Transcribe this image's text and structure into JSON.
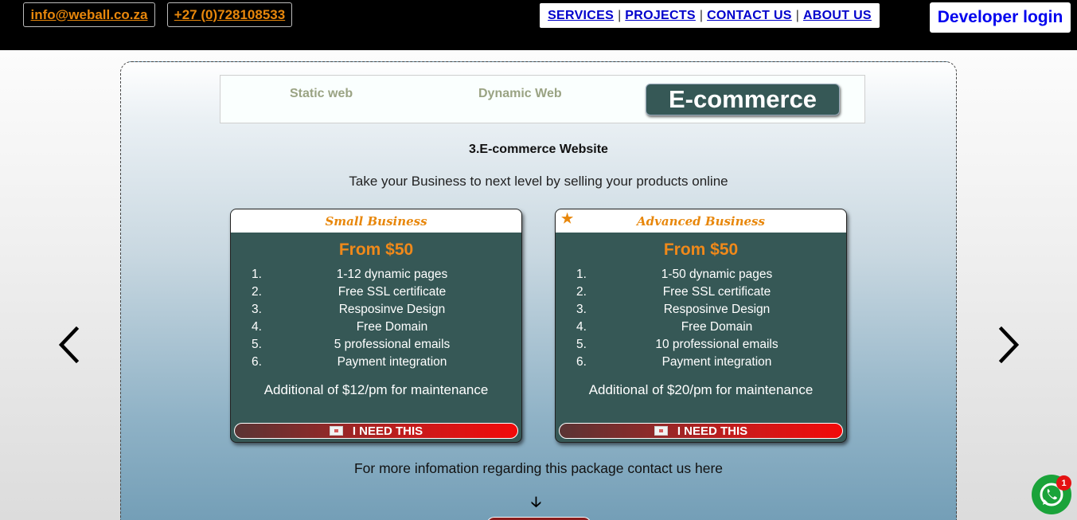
{
  "header": {
    "email": "info@weball.co.za",
    "phone": "+27 (0)728108533",
    "nav": [
      "SERVICES",
      "PROJECTS",
      "CONTACT US",
      "ABOUT US"
    ],
    "developer_login": "Developer login"
  },
  "tabs": {
    "static": "Static web",
    "dynamic": "Dynamic Web",
    "ecommerce": "E-commerce"
  },
  "section": {
    "title": "3.E-commerce Website",
    "subtitle": "Take your Business to next level by selling your products online",
    "more_info": "For more infomation regarding this package contact us here"
  },
  "cards": [
    {
      "name": "Small Business",
      "price": "From $50",
      "features": [
        {
          "num": "1.",
          "text": "1-12 dynamic pages"
        },
        {
          "num": "2.",
          "text": "Free SSL certificate"
        },
        {
          "num": "3.",
          "text": "Resposinve Design"
        },
        {
          "num": "4.",
          "text": "Free Domain"
        },
        {
          "num": "5.",
          "text": "5 professional emails"
        },
        {
          "num": "6.",
          "text": "Payment integration"
        }
      ],
      "maintenance": "Additional of $12/pm for maintenance",
      "button": "I NEED THIS"
    },
    {
      "name": "Advanced Business",
      "price": "From $50",
      "features": [
        {
          "num": "1.",
          "text": "1-50 dynamic pages"
        },
        {
          "num": "2.",
          "text": "Free SSL certificate"
        },
        {
          "num": "3.",
          "text": "Resposinve Design"
        },
        {
          "num": "4.",
          "text": "Free Domain"
        },
        {
          "num": "5.",
          "text": "10 professional emails"
        },
        {
          "num": "6.",
          "text": "Payment integration"
        }
      ],
      "maintenance": "Additional of $20/pm for maintenance",
      "button": "I NEED THIS"
    }
  ],
  "whatsapp": {
    "badge": "1"
  },
  "colors": {
    "accent": "#e8870b",
    "card_bg": "#365856",
    "button_red": "#f20a0a",
    "link_blue": "#0000cc"
  }
}
